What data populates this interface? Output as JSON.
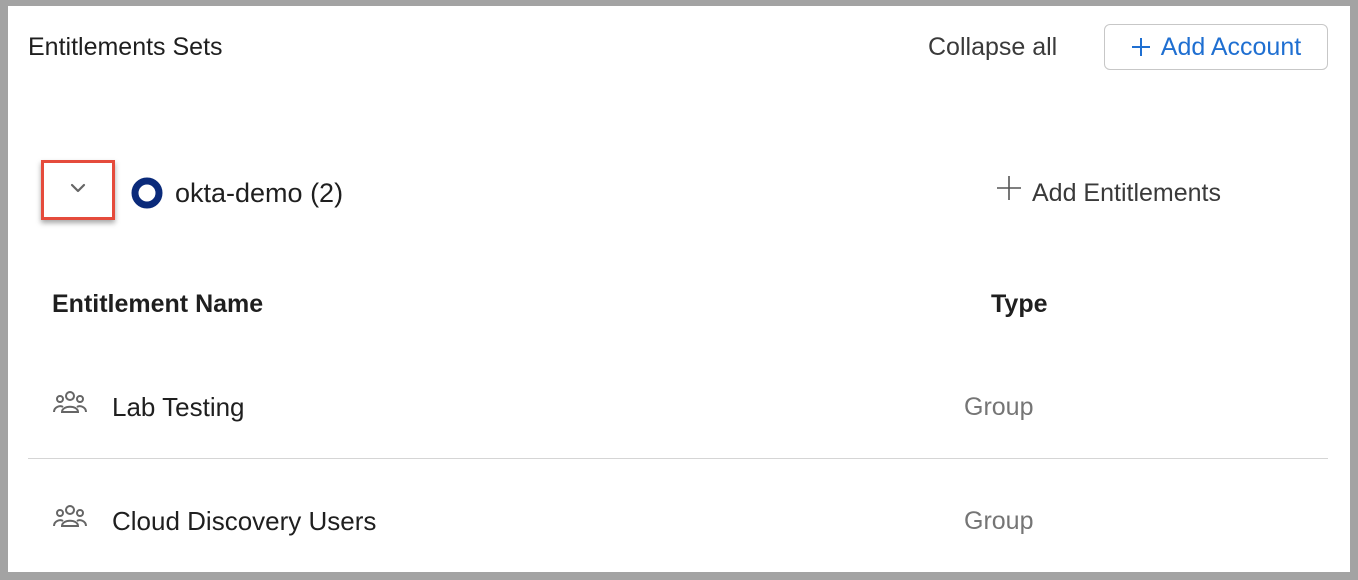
{
  "header": {
    "title": "Entitlements Sets",
    "collapse_label": "Collapse all",
    "add_account_label": "Add Account"
  },
  "colors": {
    "accent": "#1f6fd1",
    "highlight": "#e54b3c",
    "okta_blue": "#0a2a7a"
  },
  "account": {
    "name": "okta-demo (2)",
    "icon": "okta-logo",
    "expand_icon": "chevron-down-icon",
    "add_entitlements_label": "Add Entitlements"
  },
  "table": {
    "columns": [
      "Entitlement Name",
      "Type"
    ],
    "rows": [
      {
        "icon": "group-icon",
        "name": "Lab Testing",
        "type": "Group"
      },
      {
        "icon": "group-icon",
        "name": "Cloud Discovery Users",
        "type": "Group"
      }
    ]
  }
}
